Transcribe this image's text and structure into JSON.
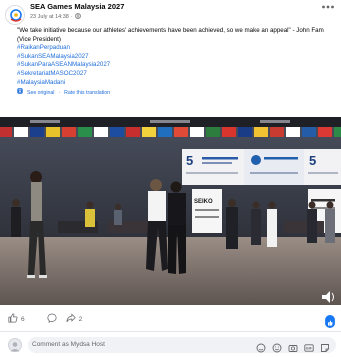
{
  "post": {
    "page_name": "SEA Games Malaysia 2027",
    "date": "23 July at 14:38",
    "quote": "\"We take initiative because our athletes' achievements have been achieved, so we make an appeal\" - John Fam (Vice President)",
    "hashtags": [
      "#RaikanPerpaduan",
      "#SukanSEAMalaysia2027",
      "#SukanParaASEANMalaysia2027",
      "#SekretariatMASOC2027",
      "#MalaysiaMadani"
    ],
    "see_original": "See original",
    "rate_translation": "Rate this translation"
  },
  "stats": {
    "reactions_count": "6",
    "shares_count": "2"
  },
  "comment": {
    "placeholder": "Comment as Mydsa Host"
  },
  "video": {
    "banner_left_number": "5",
    "banner_right_number": "5",
    "banner_sponsor": "SEIKO"
  },
  "icons": {
    "privacy": "globe-icon",
    "more": "more-options-icon",
    "translate": "translate-icon",
    "like": "like-icon",
    "comment_count": "comment-icon",
    "share": "share-icon",
    "volume": "volume-icon",
    "brand": "facebook-badge-icon",
    "comment_tools": [
      "sticker-icon",
      "emoji-icon",
      "camera-icon",
      "gif-icon",
      "sticker-square-icon"
    ]
  },
  "colors": {
    "link": "#216fdb",
    "brand": "#1877f2",
    "muted": "#65676b"
  }
}
